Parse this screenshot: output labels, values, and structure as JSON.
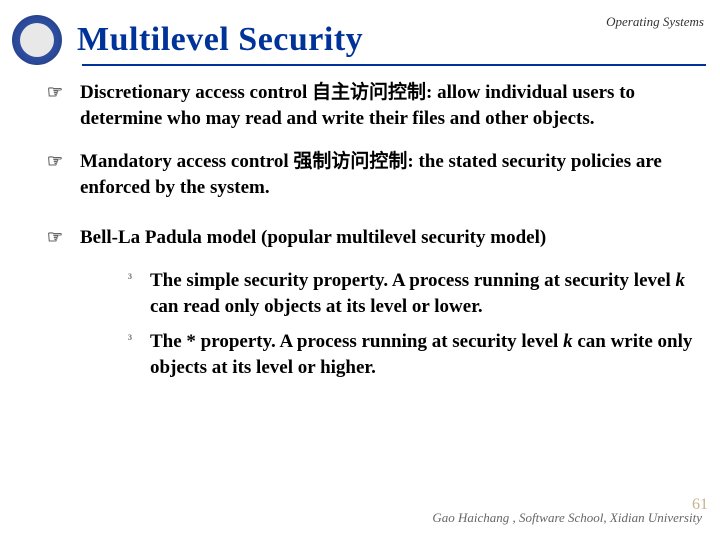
{
  "header": {
    "course": "Operating Systems",
    "title": "Multilevel Security"
  },
  "points": {
    "p1": "Discretionary access control 自主访问控制: allow individual users to determine who may read and write their files and other objects.",
    "p2": "Mandatory access control 强制访问控制: the stated security policies are enforced by the system.",
    "p3": "Bell-La Padula model (popular multilevel security model)",
    "s1a": "The simple security property. A process running at security level ",
    "s1k": "k",
    "s1b": " can read only objects at its level or lower.",
    "s2a": "The * property. A process running at security level ",
    "s2k": "k",
    "s2b": " can write only objects at its level or higher."
  },
  "bullet": {
    "main": "☞",
    "sub": "³"
  },
  "footer": {
    "credit": "Gao Haichang , Software School, Xidian University",
    "page": "61"
  }
}
